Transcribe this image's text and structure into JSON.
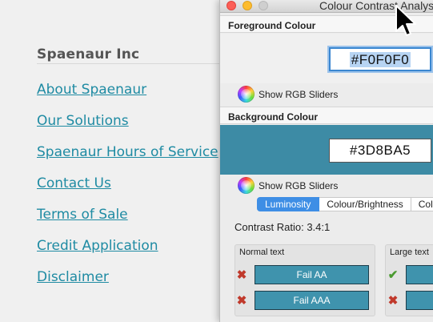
{
  "website": {
    "company_name": "Spaenaur Inc",
    "nav_links": [
      "About Spaenaur",
      "Our Solutions",
      "Spaenaur Hours of Service",
      "Contact Us",
      "Terms of Sale",
      "Credit Application",
      "Disclaimer"
    ]
  },
  "cca_window": {
    "title": "Colour Contrast Analyse",
    "foreground": {
      "heading": "Foreground Colour",
      "hex_value": "#F0F0F0",
      "color": "#f0f0f0",
      "rgb_sliders_label": "Show RGB Sliders"
    },
    "background": {
      "heading": "Background Colour",
      "hex_value": "#3D8BA5",
      "color": "#3d8ba5",
      "rgb_sliders_label": "Show RGB Sliders"
    },
    "tabs": [
      {
        "label": "Luminosity",
        "active": true
      },
      {
        "label": "Colour/Brightness",
        "active": false
      },
      {
        "label": "Col",
        "active": false
      }
    ],
    "contrast_ratio_text": "Contrast Ratio: 3.4:1",
    "normal_text": {
      "label": "Normal text",
      "results": [
        {
          "icon": "fail-cross-icon",
          "text": "Fail AA"
        },
        {
          "icon": "fail-cross-icon",
          "text": "Fail AAA"
        }
      ]
    },
    "large_text": {
      "label": "Large text",
      "results": [
        {
          "icon": "pass-check-icon",
          "text": ""
        },
        {
          "icon": "fail-cross-icon",
          "text": ""
        }
      ]
    }
  },
  "colors": {
    "link": "#1f8ba3",
    "accent_tab": "#3e8ee5",
    "result_bg": "#3f93ad",
    "fail": "#c0392b",
    "pass": "#4a9a2f"
  }
}
